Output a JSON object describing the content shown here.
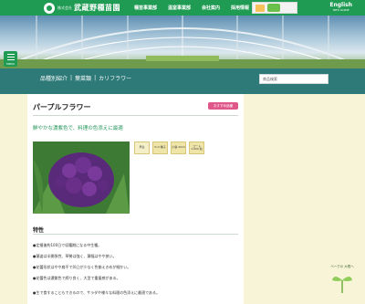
{
  "header": {
    "logo_small": "株式会社",
    "logo_name": "武蔵野種苗園",
    "nav": [
      "種苗事業部",
      "温室事業部",
      "会社案内",
      "採用情報"
    ],
    "english": "English",
    "english_sub": "INFO GUIDE"
  },
  "menu": {
    "label": "MENU"
  },
  "breadcrumb": [
    "品種別紹介",
    "葉菜類",
    "カリフラワー"
  ],
  "search": {
    "label": "商品検索"
  },
  "product": {
    "name": "パープルフラワー",
    "tag": "おすすめ品種",
    "tagline": "鮮やかな濃紫色で、料理の色添えに最適",
    "badges": [
      "早生",
      "5cd 種子",
      "小袋 20ml",
      "コート 1,000 粒"
    ],
    "features_title": "特性",
    "features": [
      "●定植後約100日で収穫期になる中生種。",
      "●葉姿は半開張性、草勢は強く、葉幅はやや狭い。",
      "●花蕾形状はやや扁平で凹凸が少なく色揃えきめが細かい。",
      "●花蕾色は濃紫色で締り良く、大型で重量感がある。",
      "●生で食することもできるので、サラダや様々な料理の色添えに最適である。"
    ]
  },
  "mascot": {
    "text": "ベーグの 大根へ"
  },
  "colors": {
    "brand_green": "#1f9b54",
    "teal": "#2d7a78",
    "accent_pink": "#e0588a",
    "bg_cream": "#f7f4d8"
  }
}
